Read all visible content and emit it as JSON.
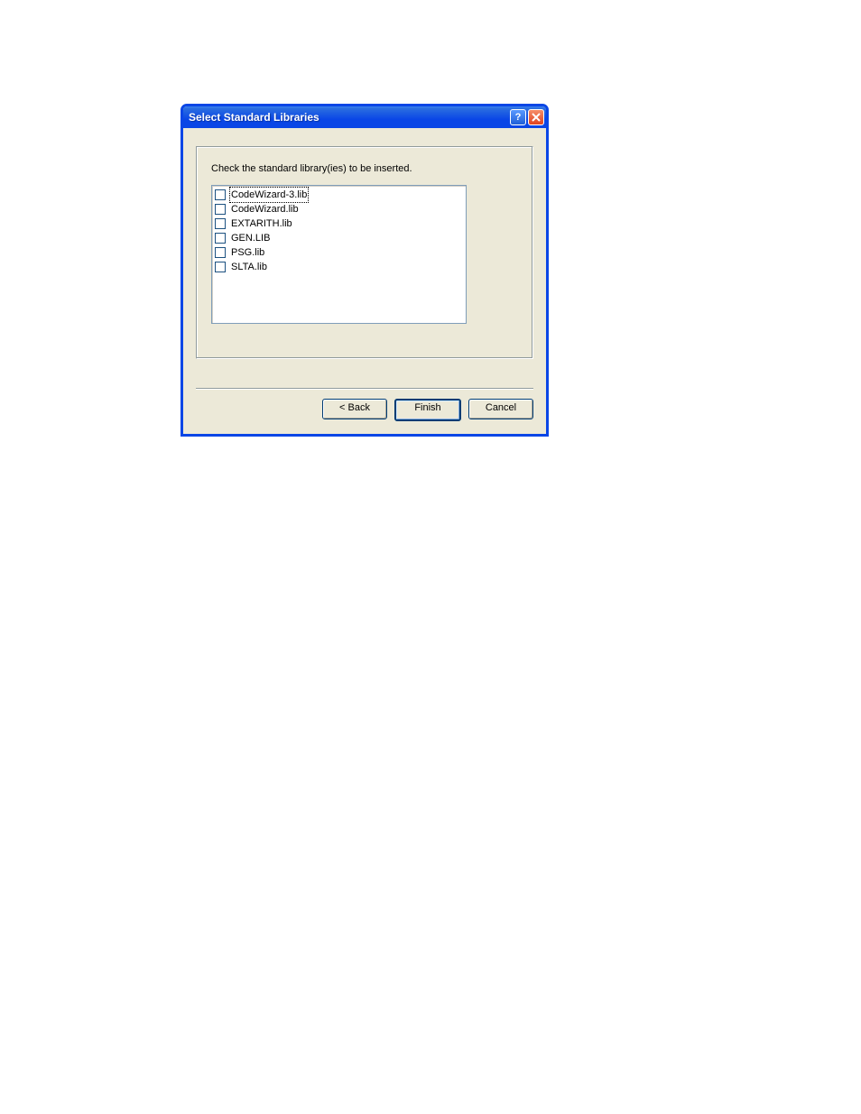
{
  "titlebar": {
    "title": "Select Standard Libraries"
  },
  "instruction": "Check the standard library(ies) to be inserted.",
  "libraries": [
    {
      "name": "CodeWizard-3.lib",
      "checked": false,
      "focused": true
    },
    {
      "name": "CodeWizard.lib",
      "checked": false,
      "focused": false
    },
    {
      "name": "EXTARITH.lib",
      "checked": false,
      "focused": false
    },
    {
      "name": "GEN.LIB",
      "checked": false,
      "focused": false
    },
    {
      "name": "PSG.lib",
      "checked": false,
      "focused": false
    },
    {
      "name": "SLTA.lib",
      "checked": false,
      "focused": false
    }
  ],
  "buttons": {
    "back": "< Back",
    "finish": "Finish",
    "cancel": "Cancel"
  }
}
